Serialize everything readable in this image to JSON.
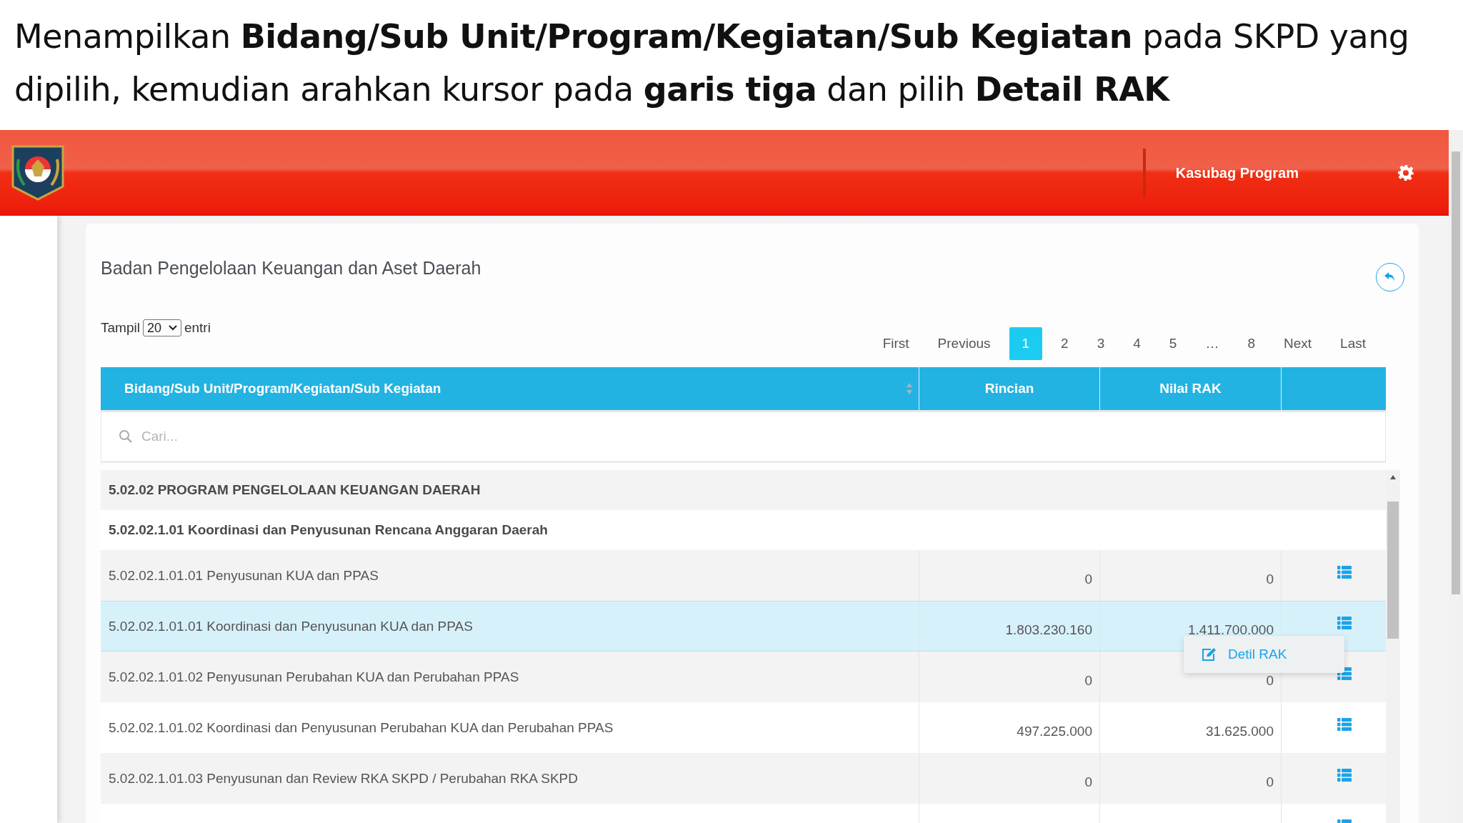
{
  "caption": "Menampilkan **Bidang/Sub Unit/Program/Kegiatan/Sub Kegiatan** pada SKPD yang dipilih, kemudian arahkan kursor pada **garis tiga** dan pilih **Detail RAK**",
  "header": {
    "user": "Kasubag Program"
  },
  "card": {
    "title": "Badan Pengelolaan Keuangan dan Aset Daerah"
  },
  "length_menu": {
    "label_before": "Tampil",
    "value": "20",
    "label_after": "entri"
  },
  "pagination": [
    {
      "label": "First",
      "selected": false
    },
    {
      "label": "Previous",
      "selected": false
    },
    {
      "label": "1",
      "selected": true
    },
    {
      "label": "2",
      "selected": false
    },
    {
      "label": "3",
      "selected": false
    },
    {
      "label": "4",
      "selected": false
    },
    {
      "label": "5",
      "selected": false
    },
    {
      "label": "…",
      "selected": false
    },
    {
      "label": "8",
      "selected": false
    },
    {
      "label": "Next",
      "selected": false
    },
    {
      "label": "Last",
      "selected": false
    }
  ],
  "table": {
    "columns": [
      "Bidang/Sub Unit/Program/Kegiatan/Sub Kegiatan",
      "Rincian",
      "Nilai RAK"
    ],
    "search": {
      "placeholder": "Cari..."
    },
    "rows": [
      {
        "kind": "group",
        "name": "5.02.02 PROGRAM PENGELOLAAN KEUANGAN DAERAH"
      },
      {
        "kind": "subgroup",
        "name": "5.02.02.1.01 Koordinasi dan Penyusunan Rencana Anggaran Daerah"
      },
      {
        "kind": "item",
        "name": "5.02.02.1.01.01 Penyusunan KUA dan PPAS",
        "rincian": "0",
        "nilai_rak": "0",
        "selected": false
      },
      {
        "kind": "item",
        "name": "5.02.02.1.01.01 Koordinasi dan Penyusunan KUA dan PPAS",
        "rincian": "1.803.230.160",
        "nilai_rak": "1.411.700.000",
        "selected": true,
        "menu": {
          "open": true,
          "items": [
            "Detil RAK"
          ]
        }
      },
      {
        "kind": "item",
        "name": "5.02.02.1.01.02 Penyusunan Perubahan KUA dan Perubahan PPAS",
        "rincian": "0",
        "nilai_rak": "0",
        "selected": false
      },
      {
        "kind": "item",
        "name": "5.02.02.1.01.02 Koordinasi dan Penyusunan Perubahan KUA dan Perubahan PPAS",
        "rincian": "497.225.000",
        "nilai_rak": "31.625.000",
        "selected": false
      },
      {
        "kind": "item",
        "name": "5.02.02.1.01.03 Penyusunan dan Review RKA SKPD / Perubahan RKA SKPD",
        "rincian": "0",
        "nilai_rak": "0",
        "selected": false
      },
      {
        "kind": "item",
        "selected": false
      }
    ]
  }
}
